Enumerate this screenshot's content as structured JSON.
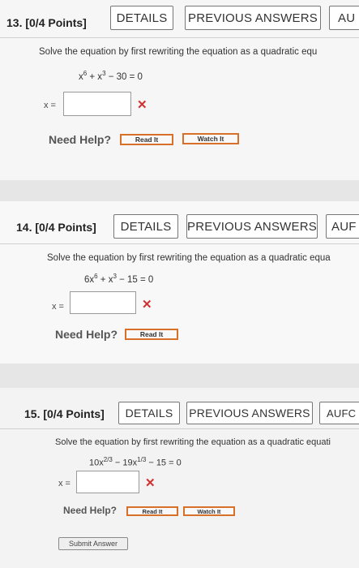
{
  "problems": [
    {
      "title": "13. [0/4 Points]",
      "details_label": "DETAILS",
      "prev_label": "PREVIOUS ANSWERS",
      "author_label": "AU",
      "instruction": "Solve the equation by first rewriting the equation as a quadratic equ",
      "equation": {
        "a": "x",
        "a_exp": "6",
        "b": " + x",
        "b_exp": "3",
        "rest": " − 30 = 0"
      },
      "x_label": "x =",
      "answer_value": "",
      "incorrect_mark": "✕",
      "need_help": "Need Help?",
      "read_label": "Read It",
      "watch_label": "Watch It"
    },
    {
      "title": "14. [0/4 Points]",
      "details_label": "DETAILS",
      "prev_label": "PREVIOUS ANSWERS",
      "author_label": "AUF",
      "instruction": "Solve the equation by first rewriting the equation as a quadratic equa",
      "equation": {
        "a": "6x",
        "a_exp": "6",
        "b": " + x",
        "b_exp": "3",
        "rest": " − 15 = 0"
      },
      "x_label": "x =",
      "answer_value": "",
      "incorrect_mark": "✕",
      "need_help": "Need Help?",
      "read_label": "Read It"
    },
    {
      "title": "15. [0/4 Points]",
      "details_label": "DETAILS",
      "prev_label": "PREVIOUS ANSWERS",
      "author_label": "AUFC",
      "instruction": "Solve the equation by first rewriting the equation as a quadratic equati",
      "equation": {
        "a": "10x",
        "a_exp": "2/3",
        "b": " − 19x",
        "b_exp": "1/3",
        "rest": " − 15 = 0"
      },
      "x_label": "x =",
      "answer_value": "",
      "incorrect_mark": "✕",
      "need_help": "Need Help?",
      "read_label": "Read It",
      "watch_label": "Watch It",
      "submit_label": "Submit Answer"
    }
  ]
}
